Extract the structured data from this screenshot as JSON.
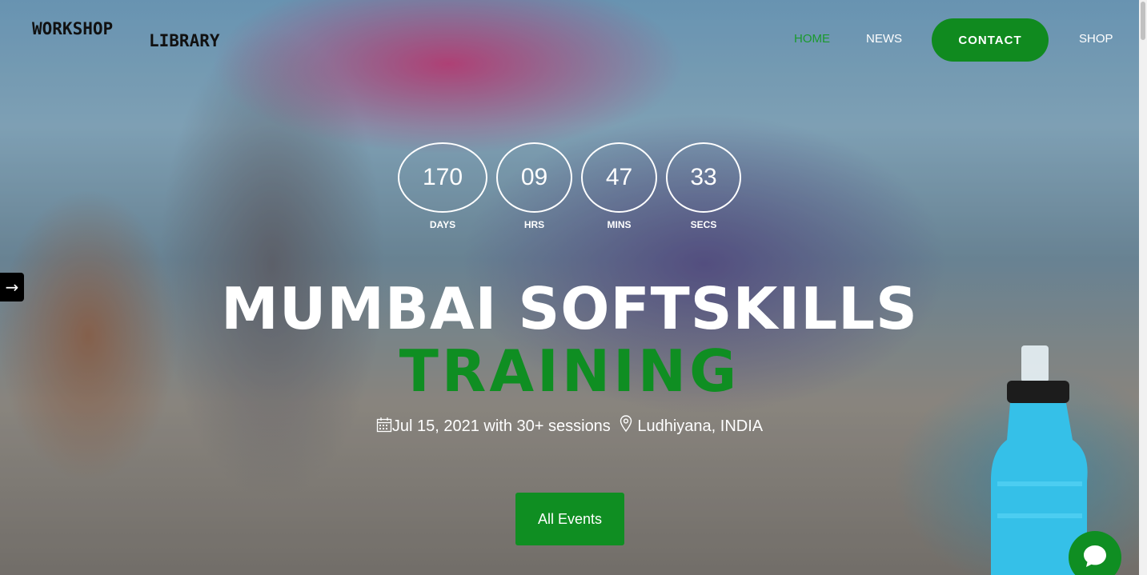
{
  "logo": {
    "line1": "WORKSHOP",
    "line2": "LIBRARY"
  },
  "nav": {
    "home": "HOME",
    "news": "NEWS",
    "contact": "CONTACT",
    "shop": "SHOP"
  },
  "side_arrow": "→",
  "countdown": {
    "days_value": "170",
    "days_label": "DAYS",
    "hrs_value": "09",
    "hrs_label": "HRS",
    "mins_value": "47",
    "mins_label": "MINS",
    "secs_value": "33",
    "secs_label": "SECS"
  },
  "event": {
    "title_line1": "MUMBAI SOFTSKILLS",
    "title_line2": "TRAINING",
    "date_sessions": "Jul 15, 2021 with 30+ sessions",
    "location": "Ludhiyana, INDIA",
    "cta": "All Events"
  },
  "colors": {
    "accent_green": "#0f8e22",
    "nav_active": "#1a9a2d"
  },
  "icons": {
    "calendar": "calendar-icon",
    "location": "location-pin-icon",
    "chat": "chat-icon"
  }
}
